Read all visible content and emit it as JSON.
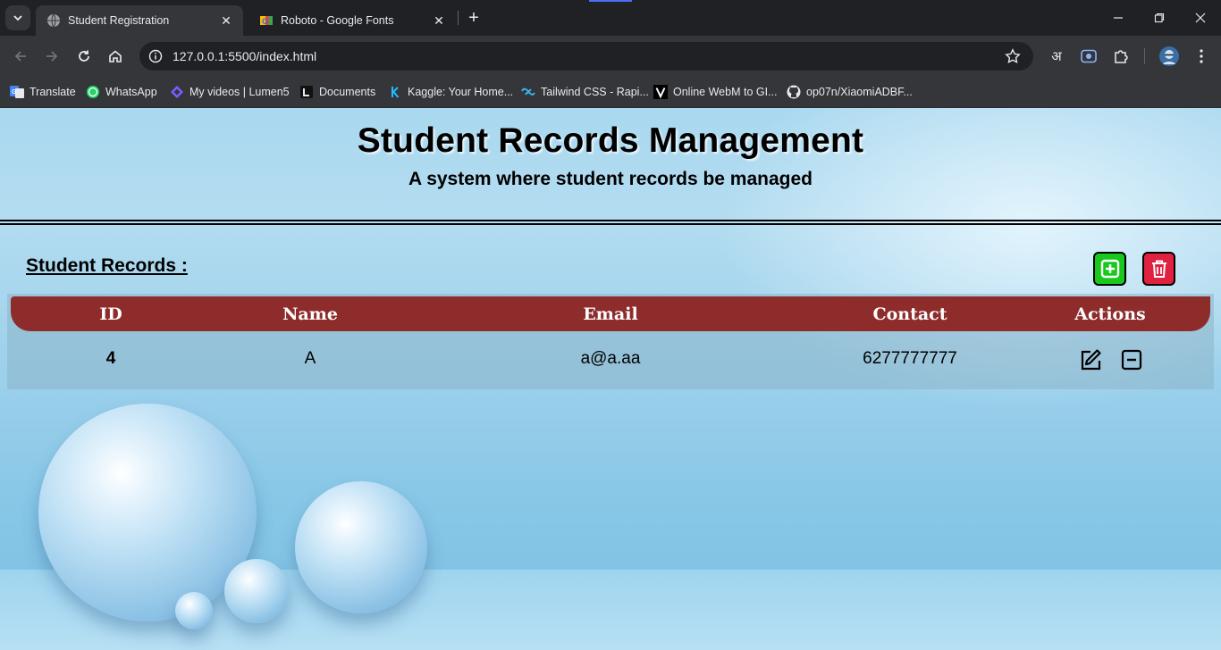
{
  "browser": {
    "tabs": [
      {
        "title": "Student Registration",
        "favicon": "globe-icon",
        "active": true
      },
      {
        "title": "Roboto - Google Fonts",
        "favicon": "google-fonts-icon",
        "active": false
      }
    ],
    "address": "127.0.0.1:5500/index.html",
    "bookmarks": [
      {
        "label": "Translate",
        "icon": "translate-icon"
      },
      {
        "label": "WhatsApp",
        "icon": "whatsapp-icon"
      },
      {
        "label": "My videos | Lumen5",
        "icon": "lumen5-icon"
      },
      {
        "label": "Documents",
        "icon": "documents-icon"
      },
      {
        "label": "Kaggle: Your Home...",
        "icon": "kaggle-icon"
      },
      {
        "label": "Tailwind CSS - Rapi...",
        "icon": "tailwind-icon"
      },
      {
        "label": "Online WebM to GI...",
        "icon": "webm-icon"
      },
      {
        "label": "op07n/XiaomiADBF...",
        "icon": "github-icon"
      }
    ],
    "extension_glyph": "अ"
  },
  "header": {
    "title": "Student Records Management",
    "subtitle": "A system where student records be managed"
  },
  "records": {
    "heading": "Student Records :",
    "columns": [
      "ID",
      "Name",
      "Email",
      "Contact",
      "Actions"
    ],
    "rows": [
      {
        "id": "4",
        "name": "A",
        "email": "a@a.aa",
        "contact": "6277777777"
      }
    ]
  },
  "colors": {
    "table_header": "#8e2c2c",
    "add_button": "#18c81c",
    "delete_button": "#e0213f",
    "chrome_dark": "#202124",
    "chrome_toolbar": "#35363a"
  }
}
